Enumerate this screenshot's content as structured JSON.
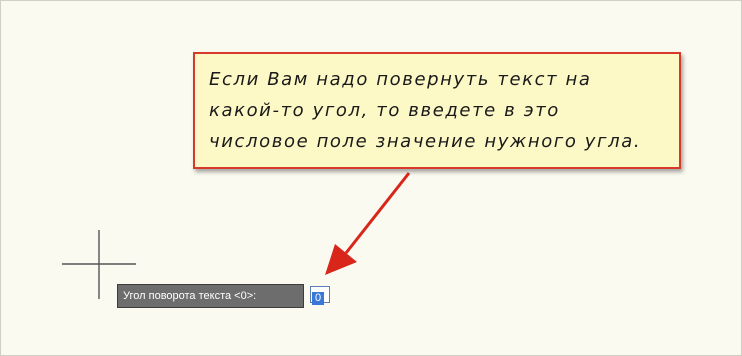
{
  "callout": {
    "lines": [
      "Если Вам надо повернуть текст на",
      "какой-то угол, то введете в это",
      "числовое поле значение нужного угла."
    ]
  },
  "prompt": {
    "label": "Угол поворота текста <0>:",
    "input_value": "0"
  },
  "colors": {
    "canvas_background": "#fbfaf0",
    "callout_background": "#fdf9c6",
    "callout_border": "#d73a2a",
    "arrow": "#d8261b",
    "crosshair": "#555555",
    "prompt_background": "#6d6d6d",
    "input_selection": "#3a78d8"
  },
  "icons": {
    "cursor": "crosshair-cursor-icon",
    "pointer": "red-arrow-icon"
  }
}
